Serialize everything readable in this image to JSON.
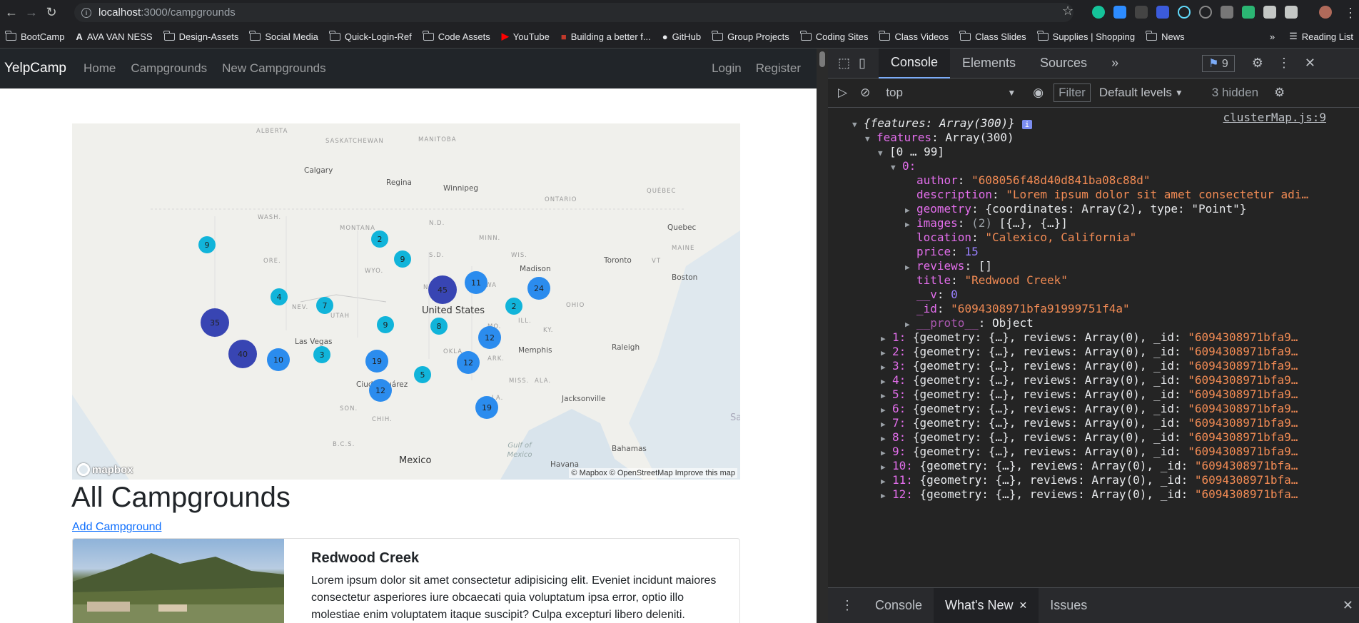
{
  "browser": {
    "url_host": "localhost",
    "url_path": ":3000/campgrounds",
    "bookmarks": [
      {
        "label": "BootCamp",
        "icon": "folder-icon"
      },
      {
        "label": "AVA VAN NESS",
        "icon": "ava-logo-icon"
      },
      {
        "label": "Design-Assets",
        "icon": "folder-icon"
      },
      {
        "label": "Social Media",
        "icon": "folder-icon"
      },
      {
        "label": "Quick-Login-Ref",
        "icon": "folder-icon"
      },
      {
        "label": "Code Assets",
        "icon": "folder-icon"
      },
      {
        "label": "YouTube",
        "icon": "youtube-icon"
      },
      {
        "label": "Building a better f...",
        "icon": "site-icon"
      },
      {
        "label": "GitHub",
        "icon": "github-icon"
      },
      {
        "label": "Group Projects",
        "icon": "folder-icon"
      },
      {
        "label": "Coding Sites",
        "icon": "folder-icon"
      },
      {
        "label": "Class Videos",
        "icon": "folder-icon"
      },
      {
        "label": "Class Slides",
        "icon": "folder-icon"
      },
      {
        "label": "Supplies | Shopping",
        "icon": "folder-icon"
      },
      {
        "label": "News",
        "icon": "folder-icon"
      }
    ],
    "more": "»",
    "reading_list": "Reading List"
  },
  "site": {
    "brand": "YelpCamp",
    "nav": [
      "Home",
      "Campgrounds",
      "New Campgrounds"
    ],
    "nav_right": [
      "Login",
      "Register"
    ],
    "title": "All Campgrounds",
    "add_link": "Add Campground",
    "card": {
      "title": "Redwood Creek",
      "text": "Lorem ipsum dolor sit amet consectetur adipisicing elit. Eveniet incidunt maiores consectetur asperiores iure obcaecati quia voluptatum ipsa error, optio illo molestiae enim voluptatem itaque suscipit? Culpa excepturi libero deleniti."
    }
  },
  "map": {
    "attribution": "© Mapbox © OpenStreetMap Improve this map",
    "logo": "mapbox",
    "labels": [
      "ALBERTA",
      "SASKATCHEWAN",
      "MANITOBA",
      "ONTARIO",
      "QUÉBEC",
      "Calgary",
      "Regina",
      "Winnipeg",
      "WASH.",
      "MONTANA",
      "N.D.",
      "MINN.",
      "S.D.",
      "WIS.",
      "Madison",
      "Toronto",
      "Quebec",
      "MAINE",
      "VT",
      "Boston",
      "ORE.",
      "WYO.",
      "NEBR.",
      "IOWA",
      "OHIO",
      "NEV.",
      "UTAH",
      "United States",
      "MO.",
      "KY.",
      "Las Vegas",
      "OKLA.",
      "ARK.",
      "Memphis",
      "Raleigh",
      "Ciudad Juárez",
      "MISS.",
      "ALA.",
      "SON.",
      "CHIH.",
      "Jacksonville",
      "LA.",
      "B.C.S.",
      "Gulf of Mexico",
      "Mexico",
      "Bahamas",
      "Havana",
      "Sa",
      "ILL."
    ],
    "clusters": [
      {
        "count": "9",
        "level": "low"
      },
      {
        "count": "2",
        "level": "low"
      },
      {
        "count": "9",
        "level": "low"
      },
      {
        "count": "45",
        "level": "high"
      },
      {
        "count": "11",
        "level": "mid"
      },
      {
        "count": "24",
        "level": "mid"
      },
      {
        "count": "4",
        "level": "low"
      },
      {
        "count": "7",
        "level": "low"
      },
      {
        "count": "2",
        "level": "low"
      },
      {
        "count": "35",
        "level": "high"
      },
      {
        "count": "9",
        "level": "low"
      },
      {
        "count": "8",
        "level": "low"
      },
      {
        "count": "12",
        "level": "mid"
      },
      {
        "count": "40",
        "level": "high"
      },
      {
        "count": "10",
        "level": "mid"
      },
      {
        "count": "3",
        "level": "low"
      },
      {
        "count": "19",
        "level": "mid"
      },
      {
        "count": "12",
        "level": "mid"
      },
      {
        "count": "5",
        "level": "low"
      },
      {
        "count": "12",
        "level": "mid"
      },
      {
        "count": "19",
        "level": "mid"
      }
    ]
  },
  "devtools": {
    "tabs": [
      "Console",
      "Elements",
      "Sources",
      "»"
    ],
    "message_count": "9",
    "context": "top",
    "filter": "Filter",
    "levels": "Default levels",
    "hidden": "3 hidden",
    "source": "clusterMap.js:9",
    "drawer_tabs": [
      "Console",
      "What's New",
      "Issues"
    ],
    "log": {
      "root": "{features: Array(300)}",
      "features_key": "features",
      "features_val": "Array(300)",
      "range": "[0 … 99]",
      "item0": "0:",
      "author": "\"608056f48d40d841ba08c88d\"",
      "description": "\"Lorem ipsum dolor sit amet consectetur adi…",
      "geometry": "{coordinates: Array(2), type: \"Point\"}",
      "images_count": "(2)",
      "images": "[{…}, {…}]",
      "location": "\"Calexico, California\"",
      "price": "15",
      "reviews": "[]",
      "title": "\"Redwood Creek\"",
      "v": "0",
      "id": "\"6094308971bfa91999751f4a\"",
      "proto": "Object",
      "rows": [
        {
          "idx": "1:",
          "id": "\"6094308971bfa9…"
        },
        {
          "idx": "2:",
          "id": "\"6094308971bfa9…"
        },
        {
          "idx": "3:",
          "id": "\"6094308971bfa9…"
        },
        {
          "idx": "4:",
          "id": "\"6094308971bfa9…"
        },
        {
          "idx": "5:",
          "id": "\"6094308971bfa9…"
        },
        {
          "idx": "6:",
          "id": "\"6094308971bfa9…"
        },
        {
          "idx": "7:",
          "id": "\"6094308971bfa9…"
        },
        {
          "idx": "8:",
          "id": "\"6094308971bfa9…"
        },
        {
          "idx": "9:",
          "id": "\"6094308971bfa9…"
        },
        {
          "idx": "10:",
          "id": "\"6094308971bfa…"
        },
        {
          "idx": "11:",
          "id": "\"6094308971bfa…"
        },
        {
          "idx": "12:",
          "id": "\"6094308971bfa…"
        }
      ],
      "row_mid": "{geometry: {…}, reviews: Array(0), _id: "
    }
  }
}
